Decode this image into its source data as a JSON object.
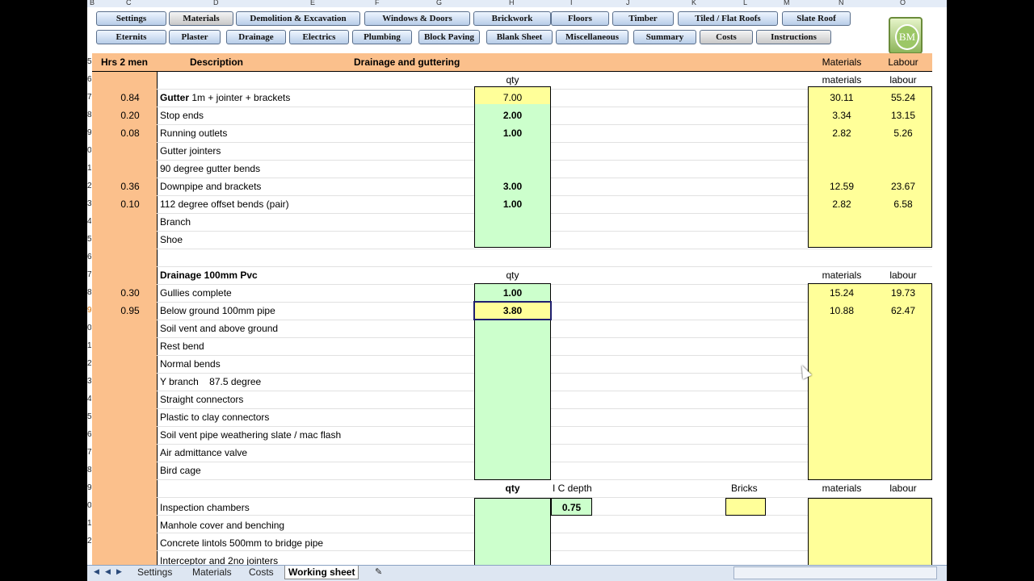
{
  "column_letters": [
    "B",
    "C",
    "D",
    "E",
    "F",
    "G",
    "H",
    "I",
    "J",
    "K",
    "L",
    "M",
    "N",
    "O"
  ],
  "toolbar": {
    "row1": [
      "Settings",
      "Materials",
      "Demolition & Excavation",
      "Windows & Doors",
      "Brickwork",
      "Floors",
      "Timber",
      "Tiled / Flat Roofs",
      "Slate Roof"
    ],
    "row2": [
      "Eternits",
      "Plaster",
      "Drainage",
      "Electrics",
      "Plumbing",
      "Block Paving",
      "Blank Sheet",
      "Miscellaneous",
      "Summary",
      "Costs",
      "Instructions"
    ],
    "logo_text": "BM"
  },
  "header": {
    "hrs": "Hrs 2 men",
    "description": "Description",
    "section": "Drainage and guttering",
    "materials": "Materials",
    "labour": "Labour"
  },
  "row_numbers": [
    "5",
    "6",
    "7",
    "8",
    "9",
    "0",
    "1",
    "2",
    "3",
    "4",
    "5",
    "6",
    "7",
    "8",
    "9",
    "0",
    "1",
    "2",
    "3",
    "4",
    "5",
    "6",
    "7",
    "8",
    "9",
    "0",
    "1",
    "2"
  ],
  "section1": {
    "qty_label": "qty",
    "materials_label": "materials",
    "labour_label": "labour",
    "rows": [
      {
        "hrs": "0.84",
        "desc_bold": "Gutter",
        "desc": " 1m + jointer + brackets",
        "qty": "7.00",
        "materials": "30.11",
        "labour": "55.24"
      },
      {
        "hrs": "0.20",
        "desc_bold": "",
        "desc": "Stop ends",
        "qty": "2.00",
        "materials": "3.34",
        "labour": "13.15"
      },
      {
        "hrs": "0.08",
        "desc_bold": "",
        "desc": "Running outlets",
        "qty": "1.00",
        "materials": "2.82",
        "labour": "5.26"
      },
      {
        "hrs": "",
        "desc_bold": "",
        "desc": "Gutter jointers",
        "qty": "",
        "materials": "",
        "labour": ""
      },
      {
        "hrs": "",
        "desc_bold": "",
        "desc": "90 degree gutter bends",
        "qty": "",
        "materials": "",
        "labour": ""
      },
      {
        "hrs": "0.36",
        "desc_bold": "",
        "desc": "Downpipe and brackets",
        "qty": "3.00",
        "materials": "12.59",
        "labour": "23.67"
      },
      {
        "hrs": "0.10",
        "desc_bold": "",
        "desc": "112 degree offset bends (pair)",
        "qty": "1.00",
        "materials": "2.82",
        "labour": "6.58"
      },
      {
        "hrs": "",
        "desc_bold": "",
        "desc": "Branch",
        "qty": "",
        "materials": "",
        "labour": ""
      },
      {
        "hrs": "",
        "desc_bold": "",
        "desc": "Shoe",
        "qty": "",
        "materials": "",
        "labour": ""
      }
    ]
  },
  "section2": {
    "title": "Drainage 100mm Pvc",
    "qty_label": "qty",
    "materials_label": "materials",
    "labour_label": "labour",
    "rows": [
      {
        "hrs": "0.30",
        "desc": "Gullies complete",
        "qty": "1.00",
        "materials": "15.24",
        "labour": "19.73"
      },
      {
        "hrs": "0.95",
        "desc": "Below ground 100mm pipe",
        "qty": "3.80",
        "materials": "10.88",
        "labour": "62.47"
      },
      {
        "hrs": "",
        "desc": "Soil vent and above ground",
        "qty": "",
        "materials": "",
        "labour": ""
      },
      {
        "hrs": "",
        "desc": "Rest bend",
        "qty": "",
        "materials": "",
        "labour": ""
      },
      {
        "hrs": "",
        "desc": "Normal bends",
        "qty": "",
        "materials": "",
        "labour": ""
      },
      {
        "hrs": "",
        "desc": "Y branch    87.5 degree",
        "qty": "",
        "materials": "",
        "labour": ""
      },
      {
        "hrs": "",
        "desc": "Straight connectors",
        "qty": "",
        "materials": "",
        "labour": ""
      },
      {
        "hrs": "",
        "desc": "Plastic to clay connectors",
        "qty": "",
        "materials": "",
        "labour": ""
      },
      {
        "hrs": "",
        "desc": "Soil vent pipe weathering slate / mac flash",
        "qty": "",
        "materials": "",
        "labour": ""
      },
      {
        "hrs": "",
        "desc": "Air admittance valve",
        "qty": "",
        "materials": "",
        "labour": ""
      },
      {
        "hrs": "",
        "desc": "Bird cage",
        "qty": "",
        "materials": "",
        "labour": ""
      }
    ]
  },
  "section3": {
    "qty_label": "qty",
    "ic_depth_label": "I C depth",
    "bricks_label": "Bricks",
    "materials_label": "materials",
    "labour_label": "labour",
    "ic_depth_value": "0.75",
    "rows": [
      {
        "desc": "Inspection chambers"
      },
      {
        "desc": "Manhole cover and benching"
      },
      {
        "desc": "Concrete lintols 500mm to bridge pipe"
      },
      {
        "desc": "Interceptor and 2no jointers"
      }
    ]
  },
  "tabs": [
    "Settings",
    "Materials",
    "Costs",
    "Working sheet"
  ],
  "active_tab": "Working sheet",
  "colors": {
    "orange": "#fbc08c",
    "green": "#ccffcc",
    "yellow": "#ffff99"
  }
}
